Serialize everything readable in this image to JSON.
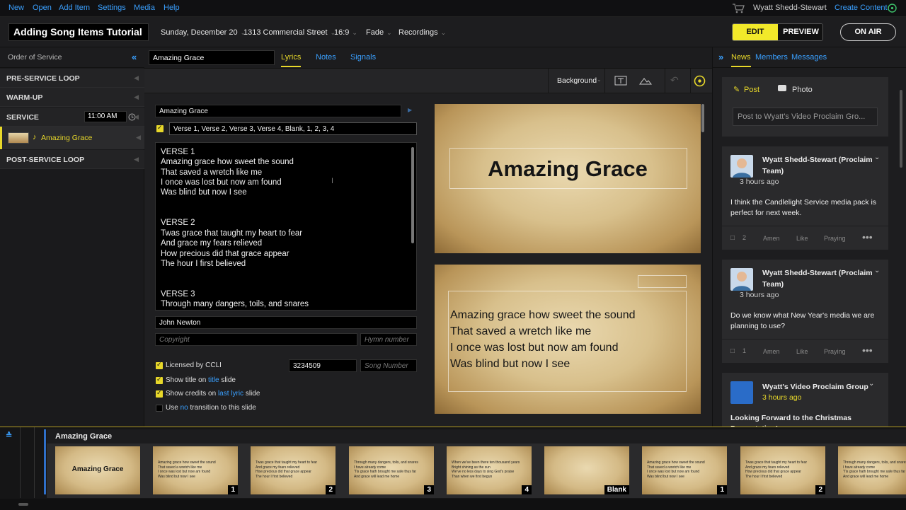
{
  "menu": {
    "items": [
      "New",
      "Open",
      "Add Item",
      "Settings",
      "Media",
      "Help"
    ],
    "user": "Wyatt Shedd-Stewart",
    "create": "Create Content"
  },
  "toolbar": {
    "title": "Adding Song Items Tutorial",
    "date": "Sunday, December 20",
    "location": "1313 Commercial Street",
    "aspect": "16:9",
    "transition": "Fade",
    "recordings": "Recordings",
    "edit": "EDIT",
    "preview": "PREVIEW",
    "onair": "ON AIR"
  },
  "order": {
    "header": "Order of Service",
    "sections": [
      "PRE-SERVICE LOOP",
      "WARM-UP",
      "SERVICE",
      "POST-SERVICE LOOP"
    ],
    "service_time": "11:00 AM",
    "item": "Amazing Grace"
  },
  "editor": {
    "item_name": "Amazing Grace",
    "tabs": [
      "Lyrics",
      "Notes",
      "Signals"
    ],
    "background": "Background",
    "song_title": "Amazing Grace",
    "sequence": "Verse 1, Verse 2, Verse 3, Verse 4, Blank, 1, 2, 3, 4",
    "lyrics": [
      "VERSE 1",
      "Amazing grace how sweet the sound",
      "That saved a wretch like me",
      "I once was lost but now am found",
      "Was blind but now I see",
      "",
      "VERSE 2",
      "Twas grace that taught my heart to fear",
      "And grace my fears relieved",
      "How precious did that grace appear",
      "The hour I first believed",
      "",
      "VERSE 3",
      "Through many dangers, toils, and snares"
    ],
    "author": "John Newton",
    "copyright_ph": "Copyright",
    "hymn_ph": "Hymn number",
    "ccli_label": "Licensed by CCLI",
    "ccli_number": "3234509",
    "song_number_ph": "Song Number",
    "opt_title_a": "Show title on ",
    "opt_title_b": "title",
    "opt_title_c": " slide",
    "opt_credits_a": "Show credits on ",
    "opt_credits_b": "last lyric",
    "opt_credits_c": " slide",
    "opt_trans_a": "Use ",
    "opt_trans_b": "no",
    "opt_trans_c": " transition to this slide"
  },
  "preview": {
    "title": "Amazing Grace",
    "lines": [
      "Amazing grace how sweet the sound",
      "That saved a wretch like me",
      "I once was lost but now am found",
      "Was blind but now I see"
    ]
  },
  "social": {
    "tabs": [
      "News",
      "Members",
      "Messages"
    ],
    "post": "Post",
    "photo": "Photo",
    "post_ph": "Post to Wyatt's Video Proclaim Gro...",
    "posts": [
      {
        "name": "Wyatt Shedd-Stewart (Proclaim Team)",
        "time": "3 hours ago",
        "body": "I think the Candlelight Service media pack is perfect for next week.",
        "count": "2"
      },
      {
        "name": "Wyatt Shedd-Stewart (Proclaim Team)",
        "time": "3 hours ago",
        "body": "Do we know what New Year's media we are planning to use?",
        "count": "1"
      },
      {
        "name": "Wyatt's Video Proclaim Group",
        "time": "3 hours ago",
        "body": "Looking Forward to the Christmas Presentation!"
      }
    ],
    "actions": [
      "Amen",
      "Like",
      "Praying"
    ]
  },
  "filmstrip": {
    "title": "Amazing Grace",
    "thumbs": [
      {
        "t": "Amazing Grace",
        "n": ""
      },
      {
        "t": "Amazing grace how sweet the sound\nThat saved a wretch like me\nI once was lost but now am found\nWas blind but now I see",
        "n": "1"
      },
      {
        "t": "Twas grace that taught my heart to fear\nAnd grace my fears relieved\nHow precious did that grace appear\nThe hour I first believed",
        "n": "2"
      },
      {
        "t": "Through many dangers, toils, and snares\nI have already come\n'Tis grace hath brought me safe thus far\nAnd grace will lead me home",
        "n": "3"
      },
      {
        "t": "When we've been there ten thousand years\nBright shining as the sun\nWe've no less days to sing God's praise\nThan when we first begun",
        "n": "4"
      },
      {
        "t": "",
        "n": "Blank"
      },
      {
        "t": "Amazing grace how sweet the sound\nThat saved a wretch like me\nI once was lost but now am found\nWas blind but now I see",
        "n": "1"
      },
      {
        "t": "Twas grace that taught my heart to fear\nAnd grace my fears relieved\nHow precious did that grace appear\nThe hour I first believed",
        "n": "2"
      },
      {
        "t": "Through many dangers, toils, and snares\nI have already come\n'Tis grace hath brought me safe thus far\nAnd grace will lead me home",
        "n": ""
      }
    ]
  }
}
